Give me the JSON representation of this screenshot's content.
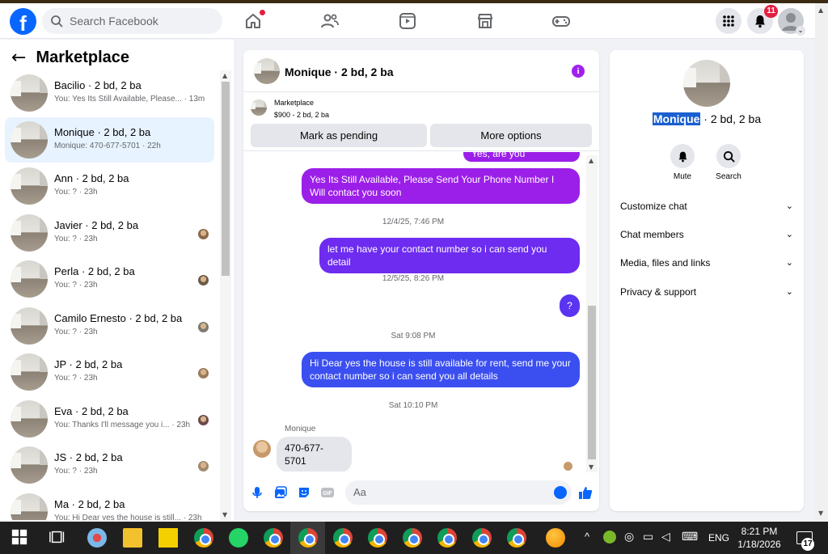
{
  "header": {
    "search_placeholder": "Search Facebook",
    "notification_count": "11"
  },
  "sidebar": {
    "title": "Marketplace",
    "conversations": [
      {
        "title": "Bacilio · 2 bd, 2 ba",
        "sub": "You: Yes Its Still Available, Please... · 13m",
        "active": false
      },
      {
        "title": "Monique · 2 bd, 2 ba",
        "sub": "Monique: 470-677-5701 · 22h",
        "active": true
      },
      {
        "title": "Ann · 2 bd, 2 ba",
        "sub": "You: ? · 23h",
        "active": false
      },
      {
        "title": "Javier · 2 bd, 2 ba",
        "sub": "You: ? · 23h",
        "active": false
      },
      {
        "title": "Perla · 2 bd, 2 ba",
        "sub": "You: ? · 23h",
        "active": false
      },
      {
        "title": "Camilo Ernesto · 2 bd, 2 ba",
        "sub": "You: ? · 23h",
        "active": false
      },
      {
        "title": "JP · 2 bd, 2 ba",
        "sub": "You: ? · 23h",
        "active": false
      },
      {
        "title": "Eva · 2 bd, 2 ba",
        "sub": "You: Thanks I'll message you i... · 23h",
        "active": false
      },
      {
        "title": "JS · 2 bd, 2 ba",
        "sub": "You: ? · 23h",
        "active": false
      },
      {
        "title": "Ma · 2 bd, 2 ba",
        "sub": "You: Hi Dear yes the house is still... · 23h",
        "active": false
      }
    ]
  },
  "chat": {
    "header_name": "Monique · 2 bd, 2 ba",
    "marketplace_label": "Marketplace",
    "listing": "$900 - 2 bd, 2 ba",
    "mark_pending": "Mark as pending",
    "more_options": "More options",
    "partial_msg": "Yes, are you interested?",
    "msg1": "Yes Its Still Available, Please Send Your Phone Number I Will contact you soon",
    "ts1": "12/4/25, 7:46 PM",
    "msg2": "let me have your contact number so i can send you detail",
    "ts2": "12/5/25, 8:26 PM",
    "msg3": "?",
    "ts3": "Sat 9:08 PM",
    "msg4": "Hi Dear yes the house is still available for rent, send me your contact number so i can send you all details",
    "ts4": "Sat 10:10 PM",
    "sender": "Monique",
    "incoming": "470-677-5701",
    "composer_placeholder": "Aa"
  },
  "details": {
    "name_highlight": "Monique",
    "name_rest": " · 2 bd, 2 ba",
    "mute": "Mute",
    "search": "Search",
    "rows": [
      "Customize chat",
      "Chat members",
      "Media, files and links",
      "Privacy & support"
    ]
  },
  "taskbar": {
    "language": "ENG",
    "time": "8:21 PM",
    "date": "1/18/2026",
    "notif": "17"
  },
  "colors": {
    "accent": "#0866ff",
    "bubble_purple": "#9b1fe8",
    "bubble_violet": "#6d2cf0",
    "bubble_blue": "#3b4ff0"
  }
}
